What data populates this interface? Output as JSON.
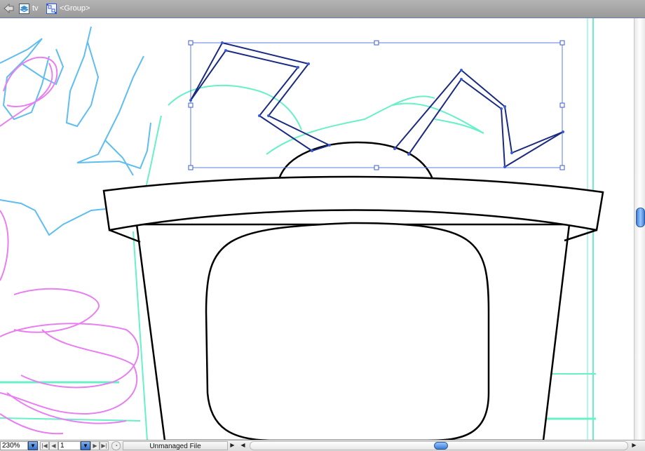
{
  "toolbar": {
    "layer_name": "tv",
    "selection_label": "<Group>"
  },
  "status": {
    "zoom": "230%",
    "page": "1",
    "file_status": "Unmanaged File"
  },
  "colors": {
    "toolbar_bg": "#a8a8a8",
    "sketch_cyan": "#5fbdf0",
    "sketch_magenta": "#e77ff0",
    "sketch_mint": "#68f0c8",
    "selection_blue": "#3a5bd6",
    "outline": "#000000"
  }
}
